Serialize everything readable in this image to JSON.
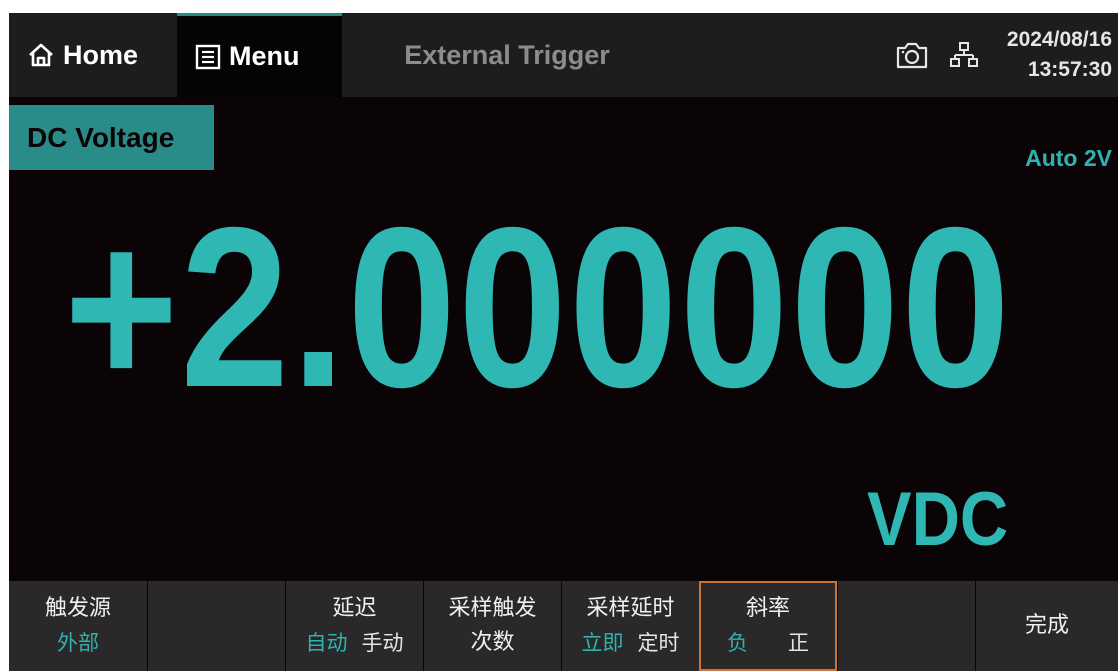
{
  "topbar": {
    "home_label": "Home",
    "menu_label": "Menu",
    "title": "External Trigger",
    "date": "2024/08/16",
    "time": "13:57:30",
    "icons": [
      "home-icon",
      "menu-list-icon",
      "camera-icon",
      "network-icon"
    ]
  },
  "measurement": {
    "function": "DC Voltage",
    "range": "Auto 2V",
    "value": "+2.000000",
    "unit": "VDC"
  },
  "softkeys": {
    "trigger_source": {
      "label": "触发源",
      "value": "外部"
    },
    "blank1": "",
    "delay": {
      "label": "延迟",
      "option_selected": "自动",
      "option_other": "手动"
    },
    "sample_trigger_count": {
      "line1": "采样触发",
      "line2": "次数"
    },
    "sample_delay": {
      "label": "采样延时",
      "option_selected": "立即",
      "option_other": "定时"
    },
    "slope": {
      "label": "斜率",
      "option_selected": "负",
      "option_other": "正"
    },
    "blank2": "",
    "done": {
      "label": "完成"
    }
  },
  "colors": {
    "accent": "#2fb7b4",
    "label_bg": "#2a8c88",
    "active_border": "#c8743a",
    "background": "#0a0406",
    "softkey_bg": "#2b2829"
  }
}
